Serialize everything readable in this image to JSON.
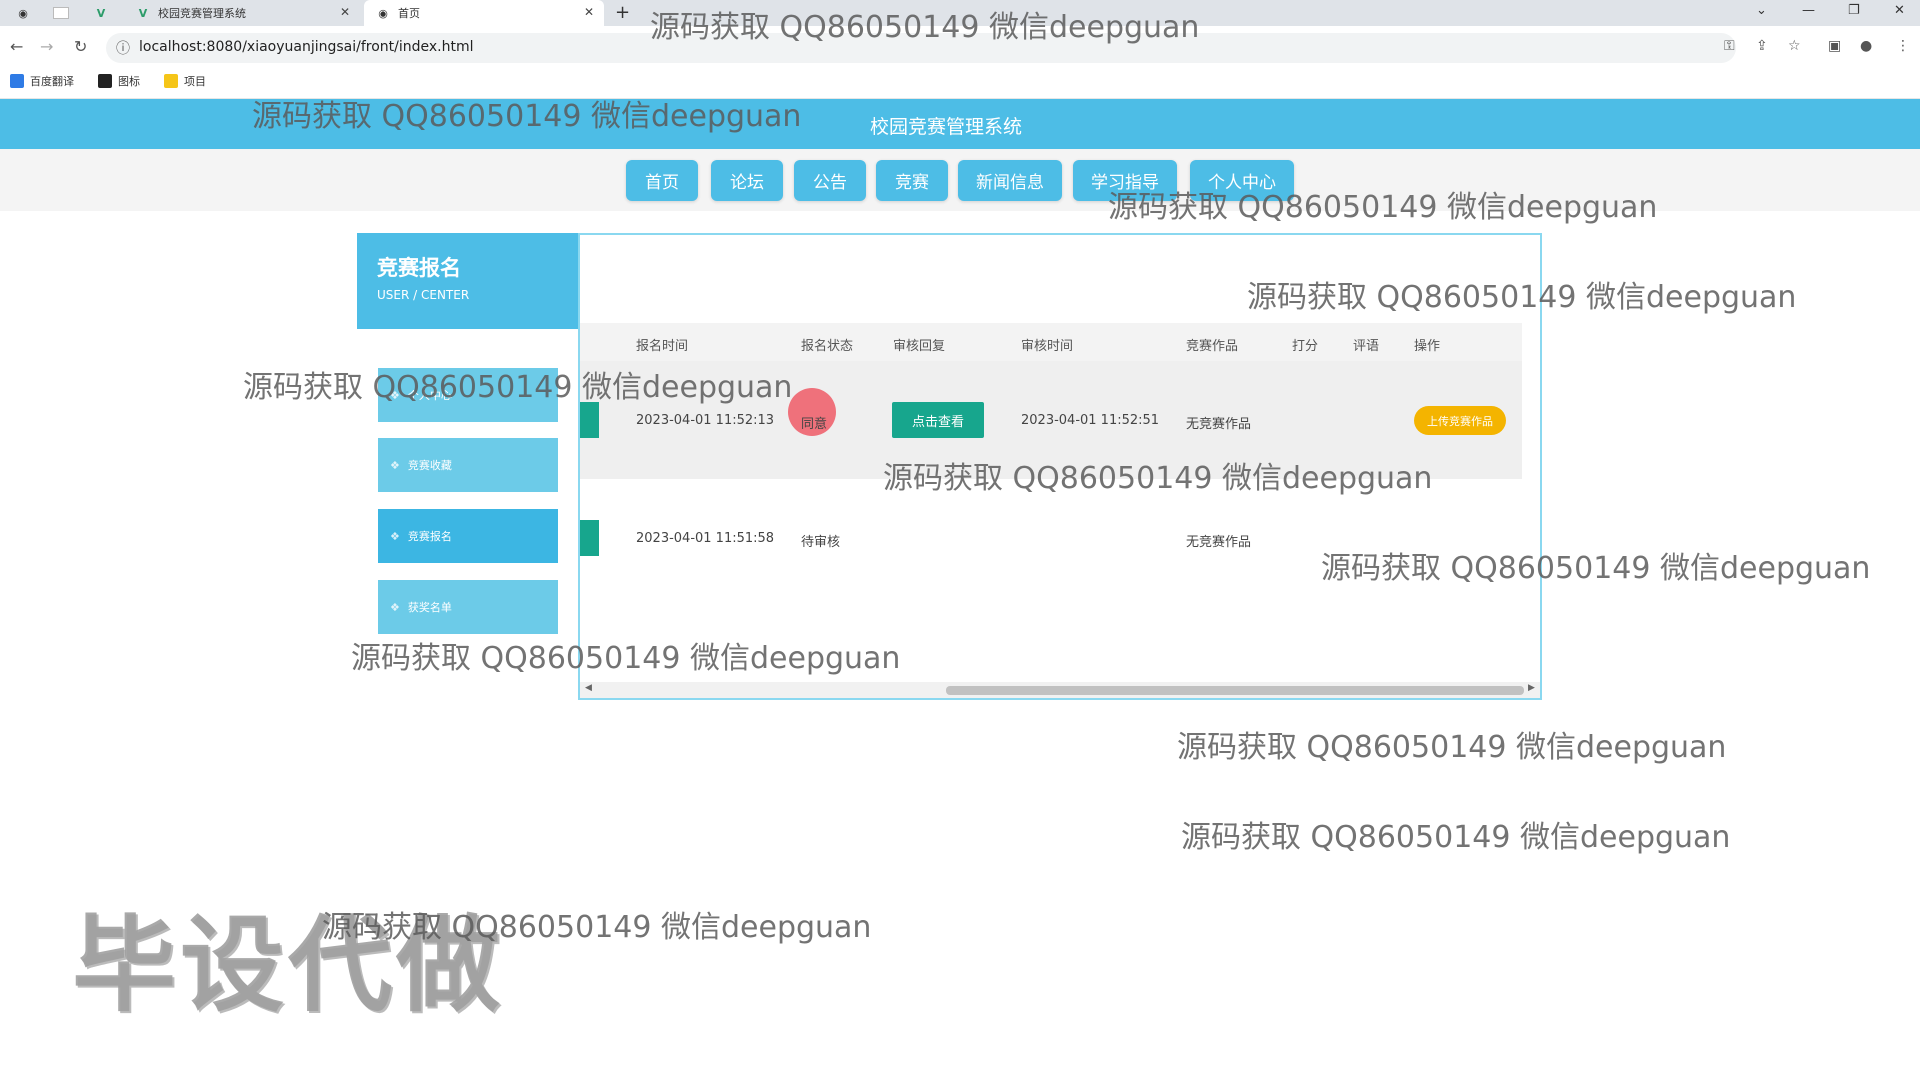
{
  "browser": {
    "tabs": [
      {
        "title": "校园竞赛管理系统",
        "active": false
      },
      {
        "title": "首页",
        "active": true
      }
    ],
    "url": "localhost:8080/xiaoyuanjingsai/front/index.html",
    "bookmarks": [
      "百度翻译",
      "图标",
      "项目"
    ]
  },
  "site": {
    "title": "校园竞赛管理系统",
    "nav": [
      "首页",
      "论坛",
      "公告",
      "竞赛",
      "新闻信息",
      "学习指导",
      "个人中心"
    ]
  },
  "sidebar": {
    "title": "竞赛报名",
    "subtitle": "USER / CENTER",
    "items": [
      {
        "label": "个人中心",
        "active": false
      },
      {
        "label": "竞赛收藏",
        "active": false
      },
      {
        "label": "竞赛报名",
        "active": true
      },
      {
        "label": "获奖名单",
        "active": false
      }
    ]
  },
  "table": {
    "columns": [
      "报名时间",
      "报名状态",
      "审核回复",
      "审核时间",
      "竞赛作品",
      "打分",
      "评语",
      "操作"
    ],
    "rows": [
      {
        "time": "2023-04-01 11:52:13",
        "status": "同意",
        "reply": "点击查看",
        "review_time": "2023-04-01 11:52:51",
        "work": "无竞赛作品",
        "score": "",
        "comment": "",
        "action": "上传竞赛作品"
      },
      {
        "time": "2023-04-01 11:51:58",
        "status": "待审核",
        "reply": "",
        "review_time": "",
        "work": "无竞赛作品",
        "score": "",
        "comment": "",
        "action": ""
      }
    ]
  },
  "watermarks": [
    "源码获取 QQ86050149 微信deepguan",
    "源码获取 QQ86050149 微信deepguan",
    "源码获取 QQ86050149 微信deepguan",
    "源码获取 QQ86050149 微信deepguan",
    "源码获取 QQ86050149 微信deepguan",
    "源码获取 QQ86050149 微信deepguan",
    "源码获取 QQ86050149 微信deepguan",
    "源码获取 QQ86050149 微信deepguan",
    "源码获取 QQ86050149 微信deepguan",
    "源码获取 QQ86050149 微信deepguan",
    "源码获取 QQ86050149 微信deepguan"
  ],
  "big_watermark": "毕设代做",
  "colors": {
    "accent": "#4dbde6",
    "teal_button": "#17a68d",
    "upload_button": "#f4b400"
  }
}
